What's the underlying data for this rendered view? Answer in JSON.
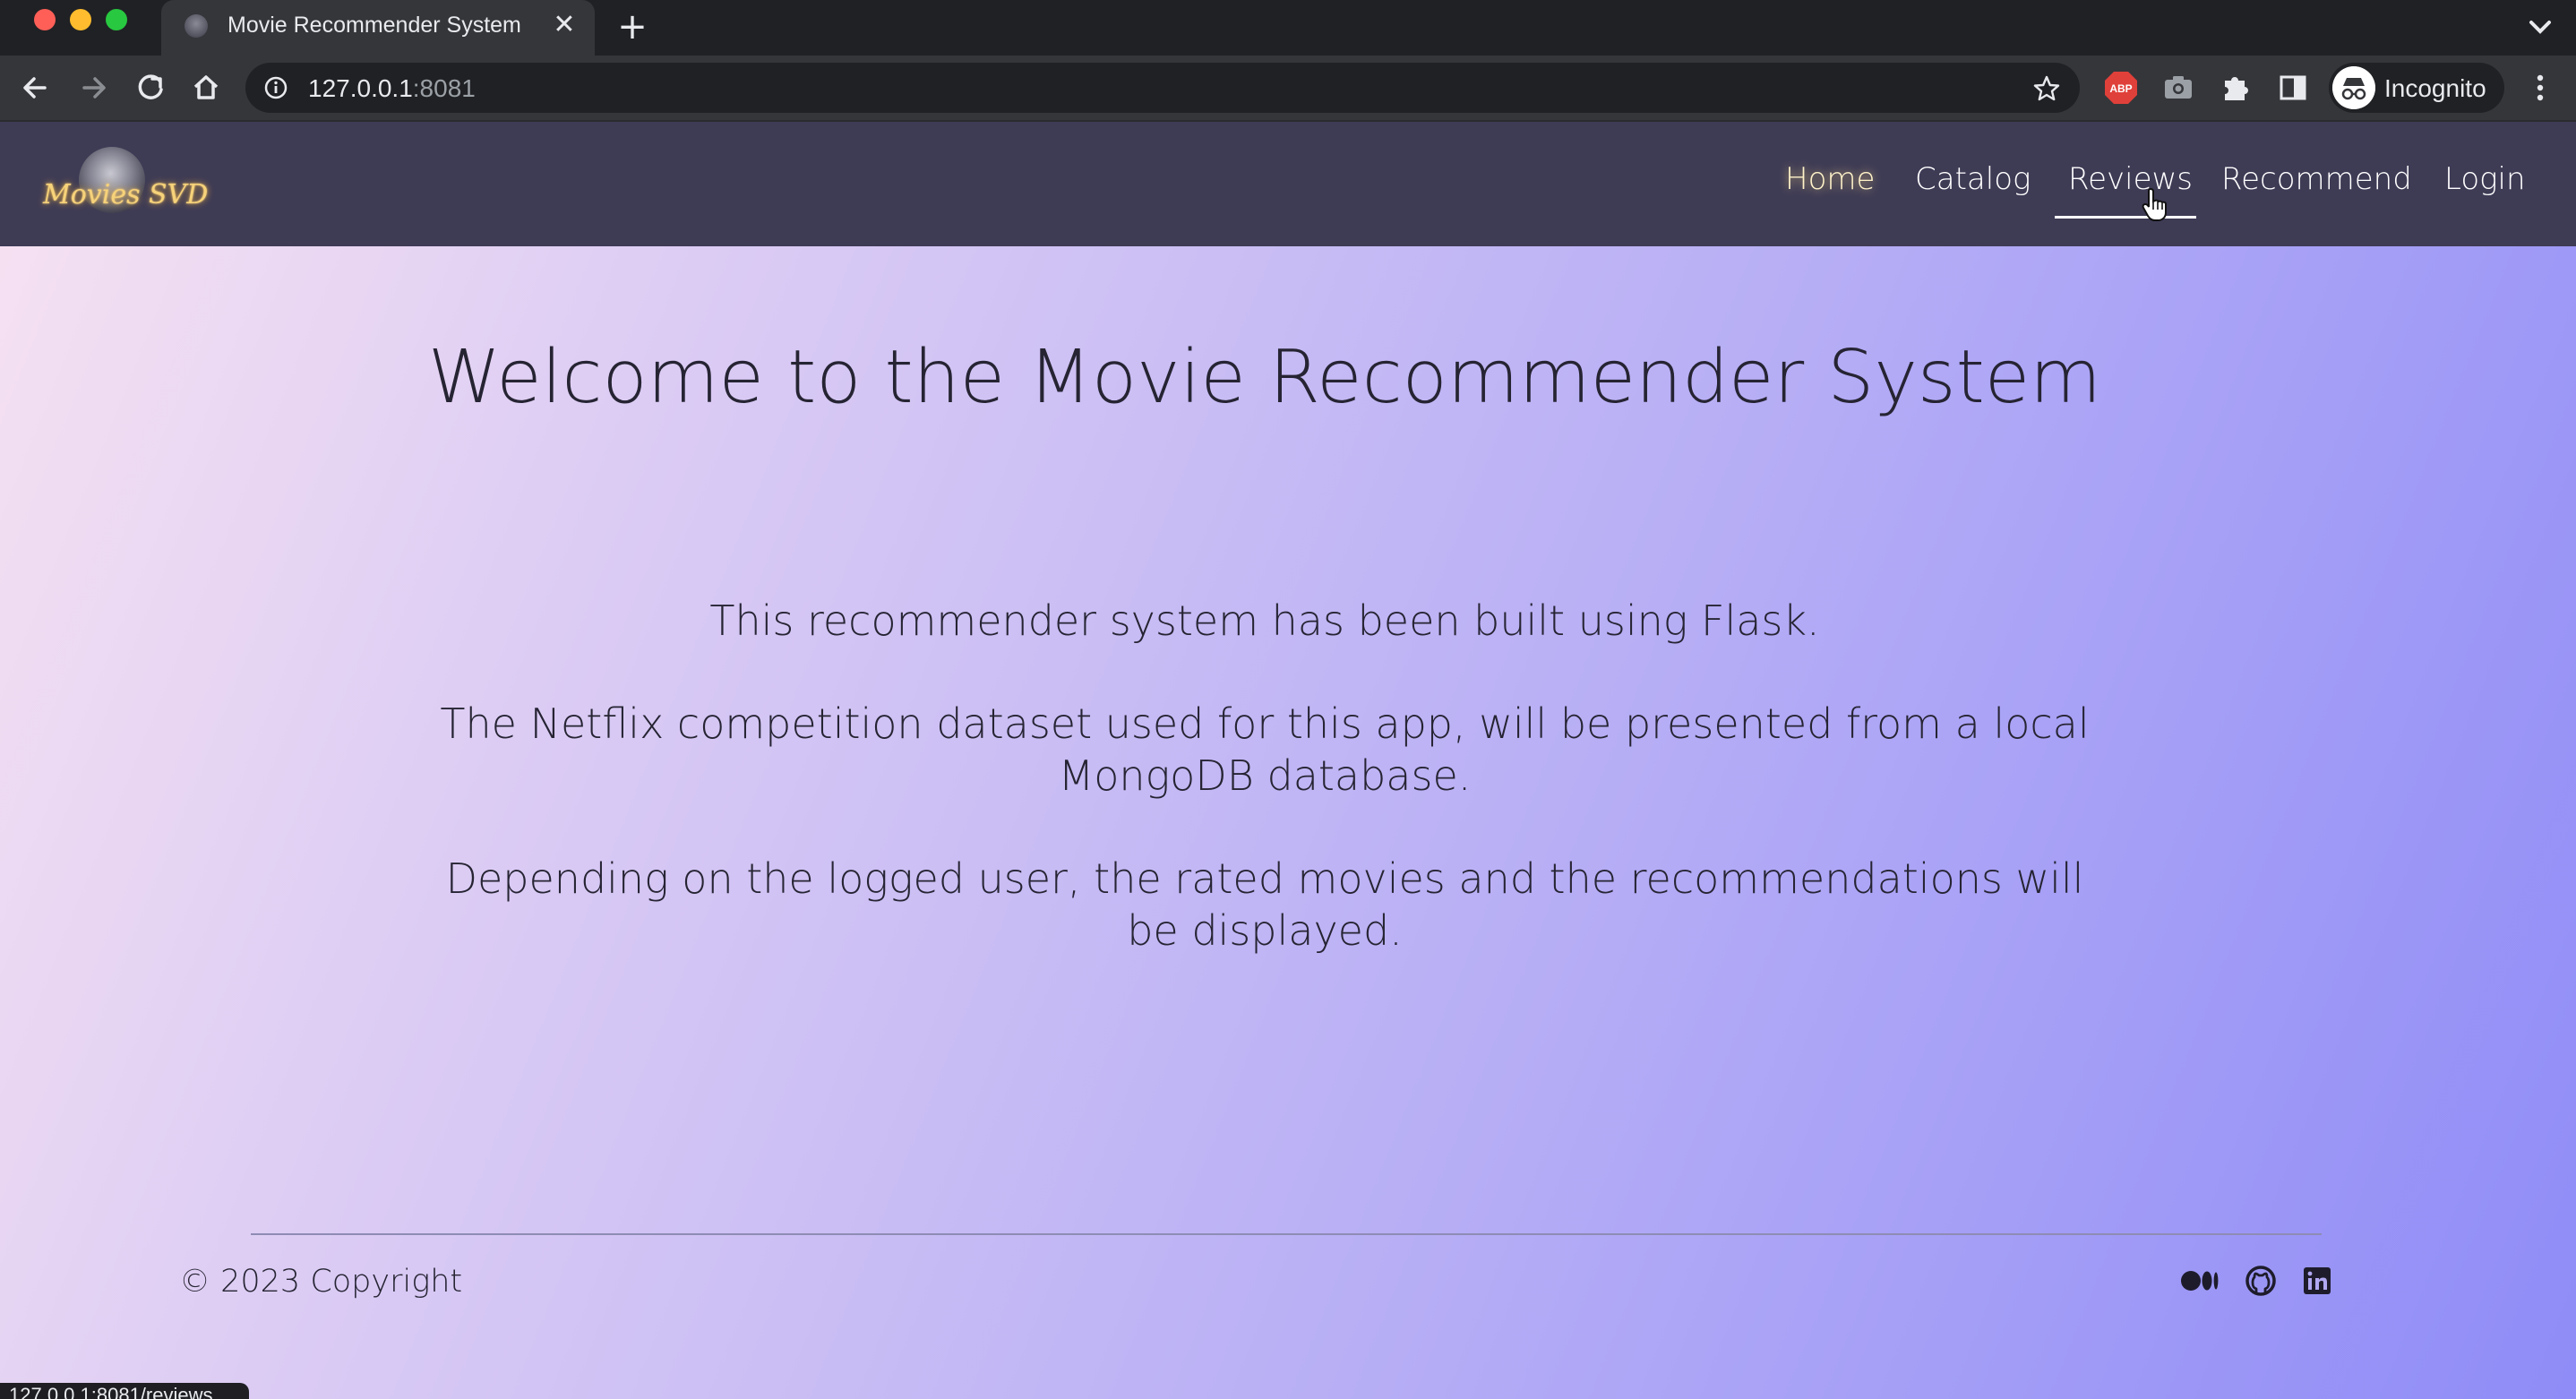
{
  "browser": {
    "tab_title": "Movie Recommender System",
    "url_host": "127.0.0.1",
    "url_port": ":8081",
    "profile_label": "Incognito",
    "status_url": "127.0.0.1:8081/reviews"
  },
  "site": {
    "logo_text": "Movies SVD",
    "nav": {
      "home": "Home",
      "catalog": "Catalog",
      "reviews": "Reviews",
      "recommend": "Recommend",
      "login": "Login"
    }
  },
  "main": {
    "heading": "Welcome to the Movie Recommender System",
    "paragraphs": [
      "This recommender system has been built using Flask.",
      "The Netflix competition dataset used for this app, will be presented from a local MongoDB database.",
      "Depending on the logged user, the rated movies and the recommendations will be displayed."
    ]
  },
  "footer": {
    "copyright": "© 2023 Copyright",
    "social_icons": [
      "medium-icon",
      "github-icon",
      "linkedin-icon"
    ]
  },
  "colors": {
    "navbar_bg": "#3e3b55",
    "home_glow": "#f2d37e",
    "text_dark": "#262433",
    "gradient_start": "#f7e2f2",
    "gradient_end": "#8f8cf7"
  }
}
